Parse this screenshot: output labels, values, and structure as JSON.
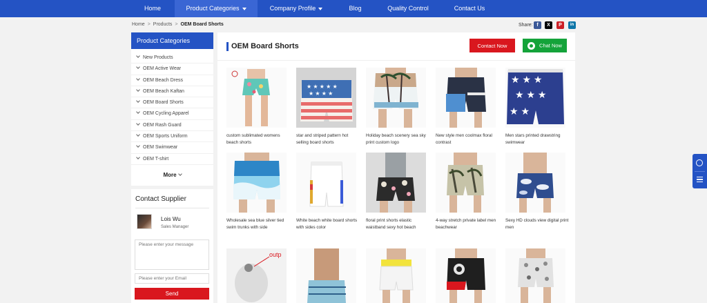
{
  "nav": {
    "items": [
      {
        "label": "Home"
      },
      {
        "label": "Product Categories"
      },
      {
        "label": "Company Profile"
      },
      {
        "label": "Blog"
      },
      {
        "label": "Quality Control"
      },
      {
        "label": "Contact Us"
      }
    ]
  },
  "breadcrumb": {
    "items": [
      "Home",
      "Products",
      "OEM Board Shorts"
    ],
    "separator": ">"
  },
  "share": {
    "label": "Share:",
    "icons": [
      {
        "name": "facebook-icon",
        "glyph": "f",
        "color": "#3b5998"
      },
      {
        "name": "x-icon",
        "glyph": "X",
        "color": "#000000"
      },
      {
        "name": "pinterest-icon",
        "glyph": "P",
        "color": "#cb2027"
      },
      {
        "name": "linkedin-icon",
        "glyph": "in",
        "color": "#0e76a8"
      }
    ]
  },
  "sidebar": {
    "heading": "Product Categories",
    "categories": [
      "New Products",
      "OEM Active Wear",
      "OEM Beach Dress",
      "OEM Beach Kaftan",
      "OEM Board Shorts",
      "OEM Cycling Apparel",
      "OEM Rash Guard",
      "OEM Sports Uniform",
      "OEM Swimwear",
      "OEM T-shirt"
    ],
    "more_label": "More"
  },
  "supplier": {
    "title": "Contact Supplier",
    "name": "Lois Wu",
    "role": "Sales Manager",
    "message_placeholder": "Please enter your message",
    "email_placeholder": "Please enter your Email",
    "send_label": "Send"
  },
  "main": {
    "title": "OEM Board Shorts",
    "contact_button": "Contact Now",
    "chat_button": "Chat Now"
  },
  "products": [
    {
      "title": "custom sublimated womens beach shorts",
      "image": "shorts-teal-floral"
    },
    {
      "title": "star and striped pattern hot selling board shorts",
      "image": "shorts-stars-stripes"
    },
    {
      "title": "Holiday beach scenery sea sky print custom logo",
      "image": "shorts-palm-scenery"
    },
    {
      "title": "New style men coolmax floral contrast",
      "image": "shorts-navy-blue-block"
    },
    {
      "title": "Men stars printed drawstring swimwear",
      "image": "shorts-navy-stars"
    },
    {
      "title": "Wholesale sea blue silver tied swim trunks with side",
      "image": "shorts-blue-wave"
    },
    {
      "title": "White beach white board shorts with sides color",
      "image": "shorts-white"
    },
    {
      "title": "floral print shorts elastic waistband sexy hot beach",
      "image": "shorts-black-floral"
    },
    {
      "title": "4-way stretch private label men beachwear",
      "image": "shorts-olive-palm"
    },
    {
      "title": "Sexy HD clouds view digital print men",
      "image": "shorts-sky-clouds"
    },
    {
      "title": "",
      "image": "fabric-sample-output"
    },
    {
      "title": "",
      "image": "shorts-light-blue-pattern"
    },
    {
      "title": "",
      "image": "shorts-white-yellow-waist"
    },
    {
      "title": "",
      "image": "shorts-black-red-graphic"
    },
    {
      "title": "",
      "image": "shorts-grey-floral"
    }
  ],
  "floating_tools": {
    "icons": [
      "whatsapp-icon",
      "menu-icon"
    ]
  },
  "colors": {
    "brand_blue": "#2453c4",
    "contact_red": "#d9171e",
    "chat_green": "#14a33a"
  }
}
